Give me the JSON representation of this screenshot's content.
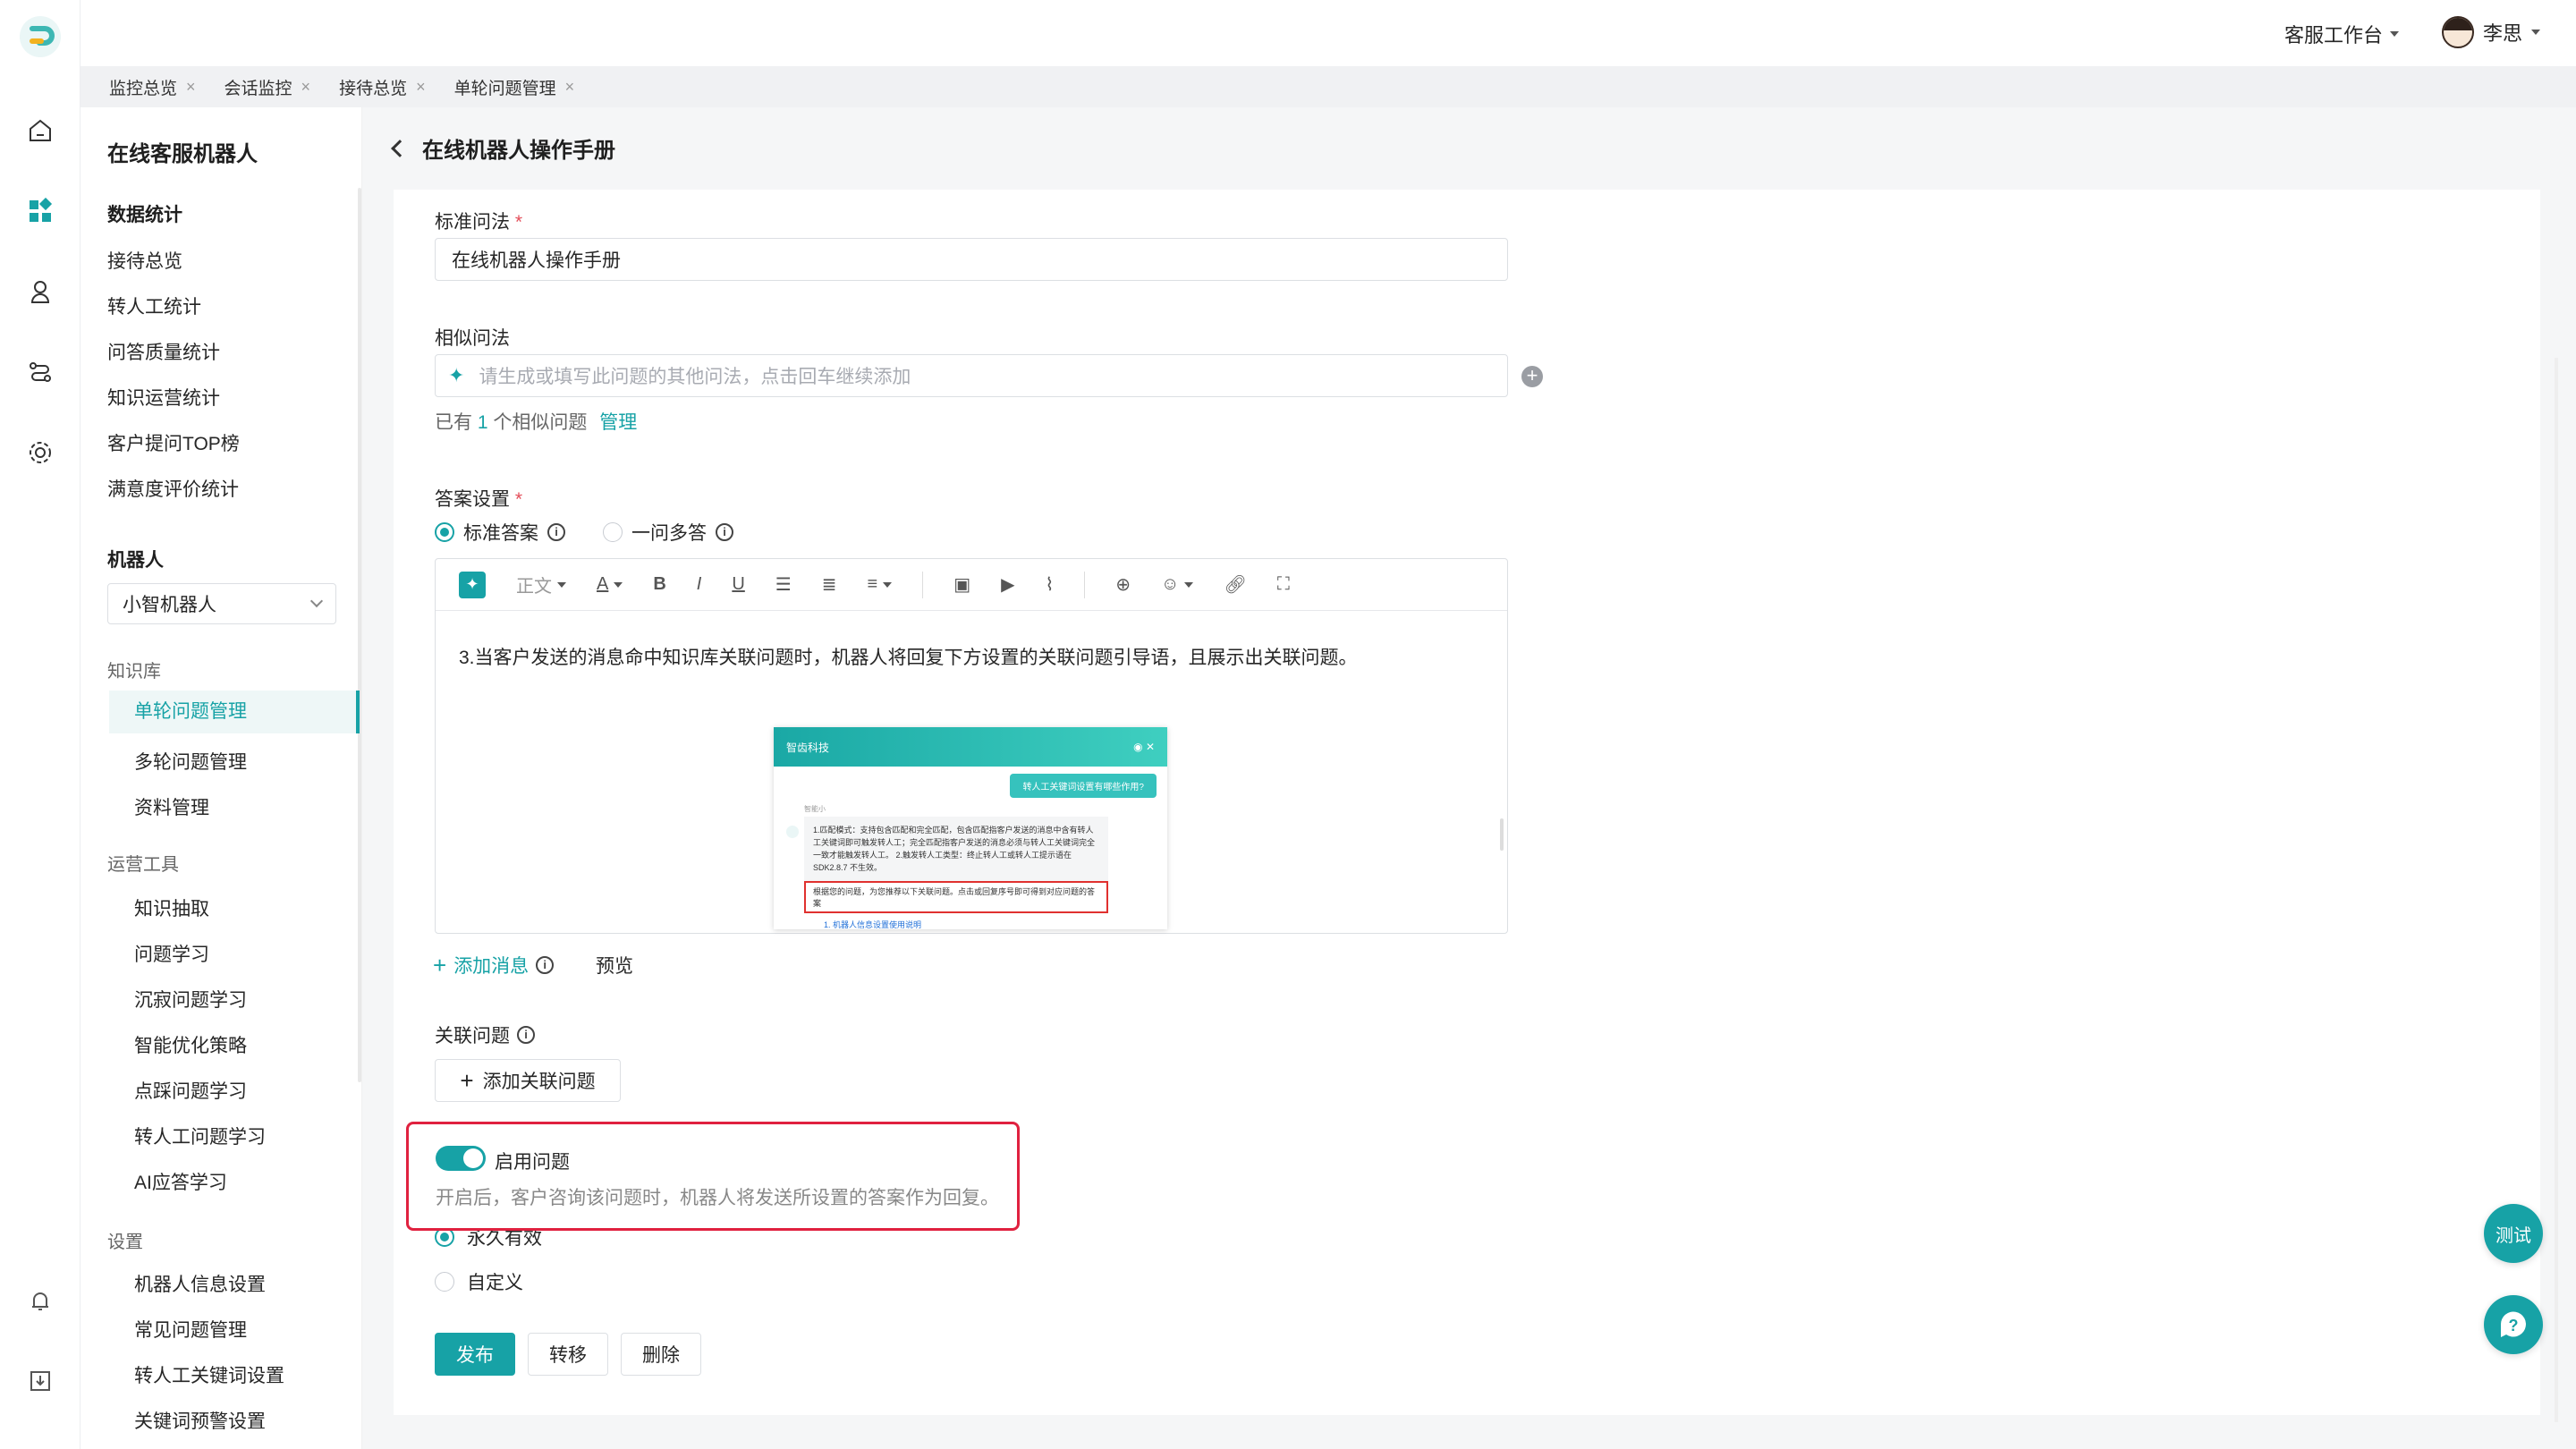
{
  "header": {
    "workspace": "客服工作台",
    "user": "李思"
  },
  "tabs": [
    {
      "label": "监控总览"
    },
    {
      "label": "会话监控"
    },
    {
      "label": "接待总览"
    },
    {
      "label": "单轮问题管理"
    }
  ],
  "sidebar": {
    "title": "在线客服机器人",
    "stats_group": "数据统计",
    "stats_items": [
      "接待总览",
      "转人工统计",
      "问答质量统计",
      "知识运营统计",
      "客户提问TOP榜",
      "满意度评价统计"
    ],
    "robot_group": "机器人",
    "robot_selected": "小智机器人",
    "kb_section": "知识库",
    "kb_items": [
      "单轮问题管理",
      "多轮问题管理",
      "资料管理"
    ],
    "ops_section": "运营工具",
    "ops_items": [
      "知识抽取",
      "问题学习",
      "沉寂问题学习",
      "智能优化策略",
      "点踩问题学习",
      "转人工问题学习",
      "AI应答学习"
    ],
    "settings_section": "设置",
    "settings_items": [
      "机器人信息设置",
      "常见问题管理",
      "转人工关键词设置",
      "关键词预警设置"
    ]
  },
  "page": {
    "title": "在线机器人操作手册",
    "standard_question_label": "标准问法",
    "standard_question_value": "在线机器人操作手册",
    "similar_label": "相似问法",
    "similar_placeholder": "请生成或填写此问题的其他问法，点击回车继续添加",
    "similar_count_prefix": "已有",
    "similar_count": "1",
    "similar_count_suffix": "个相似问题",
    "similar_manage": "管理",
    "answer_label": "答案设置",
    "answer_mode_standard": "标准答案",
    "answer_mode_multi": "一问多答",
    "toolbar_text_style": "正文",
    "editor_text": "3.当客户发送的消息命中知识库关联问题时，机器人将回复下方设置的关联问题引导语，且展示出关联问题。",
    "add_message": "添加消息",
    "preview": "预览",
    "related_label": "关联问题",
    "add_related": "添加关联问题",
    "enable_label": "启用问题",
    "enable_desc": "开启后，客户咨询该问题时，机器人将发送所设置的答案作为回复。",
    "enable_on": true,
    "validity_forever": "永久有效",
    "validity_custom": "自定义",
    "publish": "发布",
    "transfer": "转移",
    "delete": "删除"
  },
  "preview_widget": {
    "brand": "智齿科技",
    "user_bubble": "转人工关键词设置有哪些作用?",
    "bot_name": "智能小",
    "bot_answer": "1.匹配模式：支持包含匹配和完全匹配，包含匹配指客户发送的消息中含有转人工关键词即可触发转人工；完全匹配指客户发送的消息必须与转人工关键词完全一致才能触发转人工。 2.触发转人工类型：终止转人工或转人工提示语在 SDK2.8.7 不生效。",
    "highlight": "根据您的问题，为您推荐以下关联问题。点击或回复序号即可得到对应问题的答案",
    "related_link": "1. 机器人信息设置使用说明"
  },
  "floating": {
    "test": "测试"
  },
  "colors": {
    "accent": "#17a2a6",
    "highlight_border": "#e0213f"
  }
}
